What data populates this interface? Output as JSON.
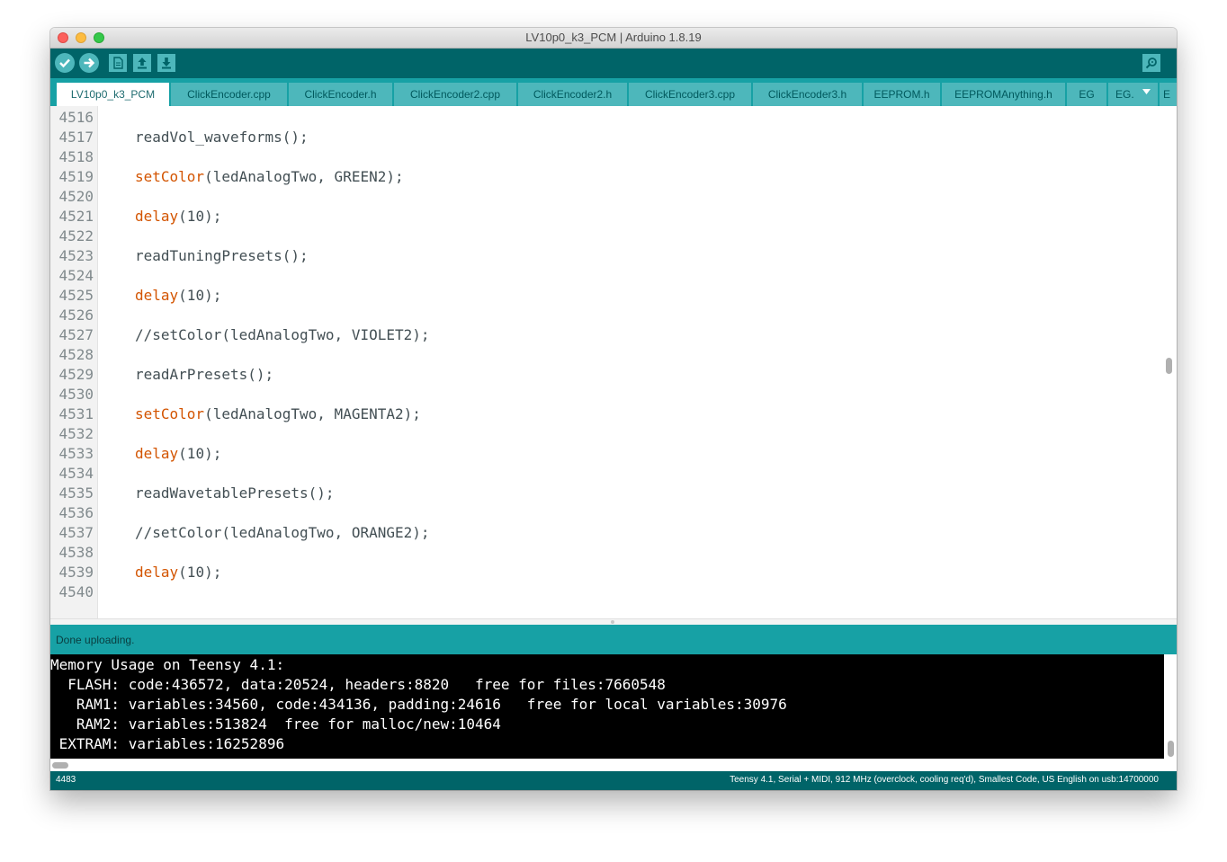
{
  "window": {
    "title": "LV10p0_k3_PCM | Arduino 1.8.19"
  },
  "toolbar": {
    "buttons": [
      "verify-icon",
      "upload-icon",
      "new-icon",
      "open-icon",
      "save-icon",
      "serial-monitor-icon"
    ]
  },
  "tabs": [
    {
      "label": "LV10p0_k3_PCM"
    },
    {
      "label": "ClickEncoder.cpp"
    },
    {
      "label": "ClickEncoder.h"
    },
    {
      "label": "ClickEncoder2.cpp"
    },
    {
      "label": "ClickEncoder2.h"
    },
    {
      "label": "ClickEncoder3.cpp"
    },
    {
      "label": "ClickEncoder3.h"
    },
    {
      "label": "EEPROM.h"
    },
    {
      "label": "EEPROMAnything.h"
    },
    {
      "label": "EG"
    },
    {
      "label": "EG."
    },
    {
      "label": "E"
    }
  ],
  "editor": {
    "line_numbers": [
      "4516",
      "4517",
      "4518",
      "4519",
      "4520",
      "4521",
      "4522",
      "4523",
      "4524",
      "4525",
      "4526",
      "4527",
      "4528",
      "4529",
      "4530",
      "4531",
      "4532",
      "4533",
      "4534",
      "4535",
      "4536",
      "4537",
      "4538",
      "4539",
      "4540"
    ],
    "code": [
      {
        "fn": "",
        "rest": "readVol_waveforms();"
      },
      {
        "fn": "setColor",
        "rest": "(ledAnalogTwo, GREEN2);"
      },
      {
        "fn": "delay",
        "rest": "(10);"
      },
      {
        "fn": "",
        "rest": "readTuningPresets();"
      },
      {
        "fn": "delay",
        "rest": "(10);"
      },
      {
        "fn": "",
        "rest": "//setColor(ledAnalogTwo, VIOLET2);"
      },
      {
        "fn": "",
        "rest": "readArPresets();"
      },
      {
        "fn": "setColor",
        "rest": "(ledAnalogTwo, MAGENTA2);"
      },
      {
        "fn": "delay",
        "rest": "(10);"
      },
      {
        "fn": "",
        "rest": "readWavetablePresets();"
      },
      {
        "fn": "",
        "rest": "//setColor(ledAnalogTwo, ORANGE2);"
      },
      {
        "fn": "delay",
        "rest": "(10);"
      }
    ]
  },
  "status": {
    "message": "Done uploading."
  },
  "console": {
    "lines": [
      "Memory Usage on Teensy 4.1:",
      "  FLASH: code:436572, data:20524, headers:8820   free for files:7660548",
      "   RAM1: variables:34560, code:434136, padding:24616   free for local variables:30976",
      "   RAM2: variables:513824  free for malloc/new:10464",
      " EXTRAM: variables:16252896"
    ]
  },
  "footer": {
    "line": "4483",
    "board": "Teensy 4.1, Serial + MIDI, 912 MHz (overclock, cooling req'd), Smallest Code, US English on usb:14700000"
  },
  "colors": {
    "toolbar": "#006468",
    "tabbar": "#17a1a5",
    "keyword": "#d35400"
  }
}
